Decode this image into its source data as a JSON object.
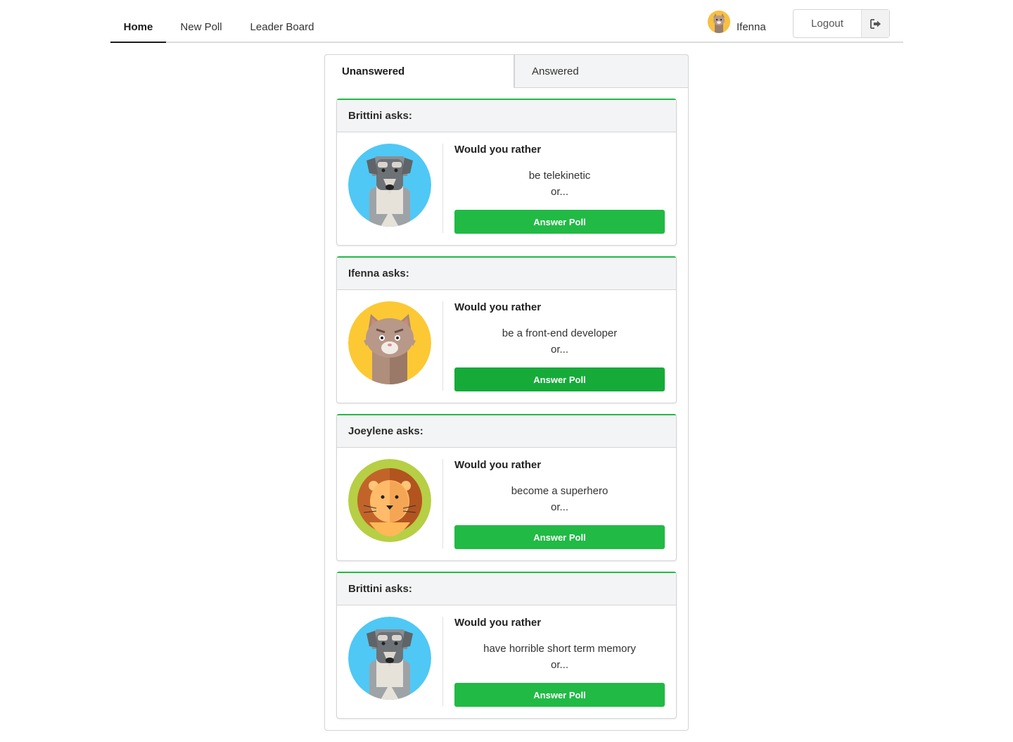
{
  "nav": {
    "items": [
      {
        "label": "Home",
        "active": true
      },
      {
        "label": "New Poll",
        "active": false
      },
      {
        "label": "Leader Board",
        "active": false
      }
    ],
    "user_name": "Ifenna",
    "logout_label": "Logout"
  },
  "tabs": [
    {
      "label": "Unanswered",
      "active": true
    },
    {
      "label": "Answered",
      "active": false
    }
  ],
  "polls": [
    {
      "asker_label": "Brittini asks:",
      "avatar": "dog-avatar-icon",
      "prompt": "Would you rather",
      "option": "be telekinetic",
      "or_text": "or...",
      "button_label": "Answer Poll"
    },
    {
      "asker_label": "Ifenna asks:",
      "avatar": "cat-avatar-icon",
      "prompt": "Would you rather",
      "option": "be a front-end developer",
      "or_text": "or...",
      "button_label": "Answer Poll"
    },
    {
      "asker_label": "Joeylene asks:",
      "avatar": "lion-avatar-icon",
      "prompt": "Would you rather",
      "option": "become a superhero",
      "or_text": "or...",
      "button_label": "Answer Poll"
    },
    {
      "asker_label": "Brittini asks:",
      "avatar": "dog-avatar-icon",
      "prompt": "Would you rather",
      "option": "have horrible short term memory",
      "or_text": "or...",
      "button_label": "Answer Poll"
    }
  ],
  "colors": {
    "accent": "#21ba45",
    "card_header": "#f3f4f5",
    "border": "#d4d4d5"
  }
}
